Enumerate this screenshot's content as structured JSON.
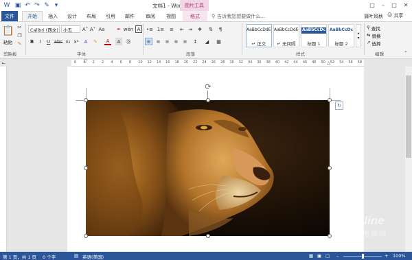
{
  "window": {
    "title": "文档1 - Word",
    "contextual_tab_group": "图片工具",
    "user": "蒲叶风秋",
    "share_label": "共享"
  },
  "tabs": [
    {
      "label": "文件"
    },
    {
      "label": "开始"
    },
    {
      "label": "插入"
    },
    {
      "label": "设计"
    },
    {
      "label": "布局"
    },
    {
      "label": "引用"
    },
    {
      "label": "邮件"
    },
    {
      "label": "审阅"
    },
    {
      "label": "视图"
    },
    {
      "label": "格式"
    }
  ],
  "tell_me": "告诉我您想要做什么...",
  "ribbon": {
    "clipboard": {
      "label": "剪贴板",
      "paste_label": "粘贴"
    },
    "font": {
      "label": "字体",
      "font_name": "Calibri (西文)",
      "font_size": "小五"
    },
    "paragraph": {
      "label": "段落"
    },
    "styles": {
      "label": "样式",
      "items": [
        {
          "sample": "AaBbCcDdEe",
          "name": "↵ 正文"
        },
        {
          "sample": "AaBbCcDdEe",
          "name": "↵ 无间隔"
        },
        {
          "sample": "AaBbCcDc",
          "name": "标题 1"
        },
        {
          "sample": "AaBbCcDc",
          "name": "标题 2"
        }
      ]
    },
    "editing": {
      "label": "编辑",
      "find": "查找",
      "replace": "替换",
      "select": "选择"
    }
  },
  "ruler_ticks": [
    "6",
    "4",
    "2",
    "2",
    "4",
    "6",
    "8",
    "10",
    "12",
    "14",
    "16",
    "18",
    "20",
    "22",
    "24",
    "26",
    "28",
    "30",
    "32",
    "34",
    "36",
    "38",
    "40",
    "42",
    "44",
    "46",
    "48",
    "50",
    "52",
    "54",
    "56",
    "58"
  ],
  "status": {
    "page": "第 1 页，共 1 页",
    "words": "0 个字",
    "language": "英语(美国)",
    "zoom": "100%"
  },
  "watermark": {
    "brand": "PConline",
    "sub": "太平洋电脑网"
  },
  "colors": {
    "accent": "#2b579a",
    "contextual": "#a4375f"
  }
}
